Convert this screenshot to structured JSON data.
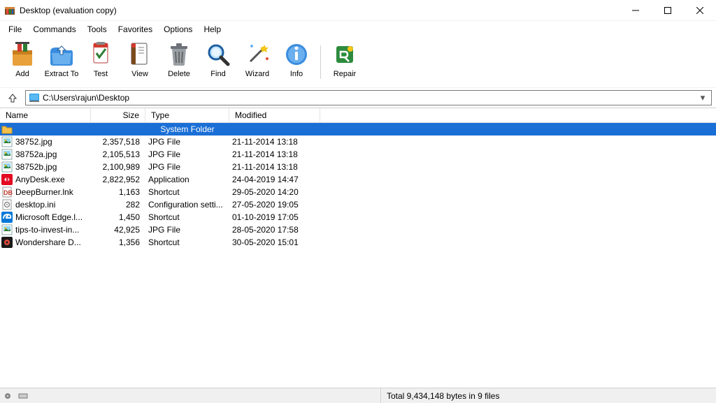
{
  "window": {
    "title": "Desktop (evaluation copy)"
  },
  "menu": {
    "items": [
      "File",
      "Commands",
      "Tools",
      "Favorites",
      "Options",
      "Help"
    ]
  },
  "toolbar": {
    "buttons": [
      {
        "id": "add",
        "label": "Add"
      },
      {
        "id": "extract",
        "label": "Extract To"
      },
      {
        "id": "test",
        "label": "Test"
      },
      {
        "id": "view",
        "label": "View"
      },
      {
        "id": "delete",
        "label": "Delete"
      },
      {
        "id": "find",
        "label": "Find"
      },
      {
        "id": "wizard",
        "label": "Wizard"
      },
      {
        "id": "info",
        "label": "Info"
      }
    ],
    "repair": {
      "id": "repair",
      "label": "Repair"
    }
  },
  "address": {
    "path": "C:\\Users\\rajun\\Desktop"
  },
  "columns": {
    "name": "Name",
    "size": "Size",
    "type": "Type",
    "modified": "Modified"
  },
  "parent_row": {
    "type_label": "System Folder"
  },
  "files": [
    {
      "icon": "img",
      "name": "38752.jpg",
      "size": "2,357,518",
      "type": "JPG File",
      "modified": "21-11-2014 13:18"
    },
    {
      "icon": "img",
      "name": "38752a.jpg",
      "size": "2,105,513",
      "type": "JPG File",
      "modified": "21-11-2014 13:18"
    },
    {
      "icon": "img",
      "name": "38752b.jpg",
      "size": "2,100,989",
      "type": "JPG File",
      "modified": "21-11-2014 13:18"
    },
    {
      "icon": "anydesk",
      "name": "AnyDesk.exe",
      "size": "2,822,952",
      "type": "Application",
      "modified": "24-04-2019 14:47"
    },
    {
      "icon": "db",
      "name": "DeepBurner.lnk",
      "size": "1,163",
      "type": "Shortcut",
      "modified": "29-05-2020 14:20"
    },
    {
      "icon": "cfg",
      "name": "desktop.ini",
      "size": "282",
      "type": "Configuration setti...",
      "modified": "27-05-2020 19:05"
    },
    {
      "icon": "edge",
      "name": "Microsoft Edge.l...",
      "size": "1,450",
      "type": "Shortcut",
      "modified": "01-10-2019 17:05"
    },
    {
      "icon": "img",
      "name": "tips-to-invest-in...",
      "size": "42,925",
      "type": "JPG File",
      "modified": "28-05-2020 17:58"
    },
    {
      "icon": "ws",
      "name": "Wondershare D...",
      "size": "1,356",
      "type": "Shortcut",
      "modified": "30-05-2020 15:01"
    }
  ],
  "status": {
    "total": "Total 9,434,148 bytes in 9 files"
  }
}
